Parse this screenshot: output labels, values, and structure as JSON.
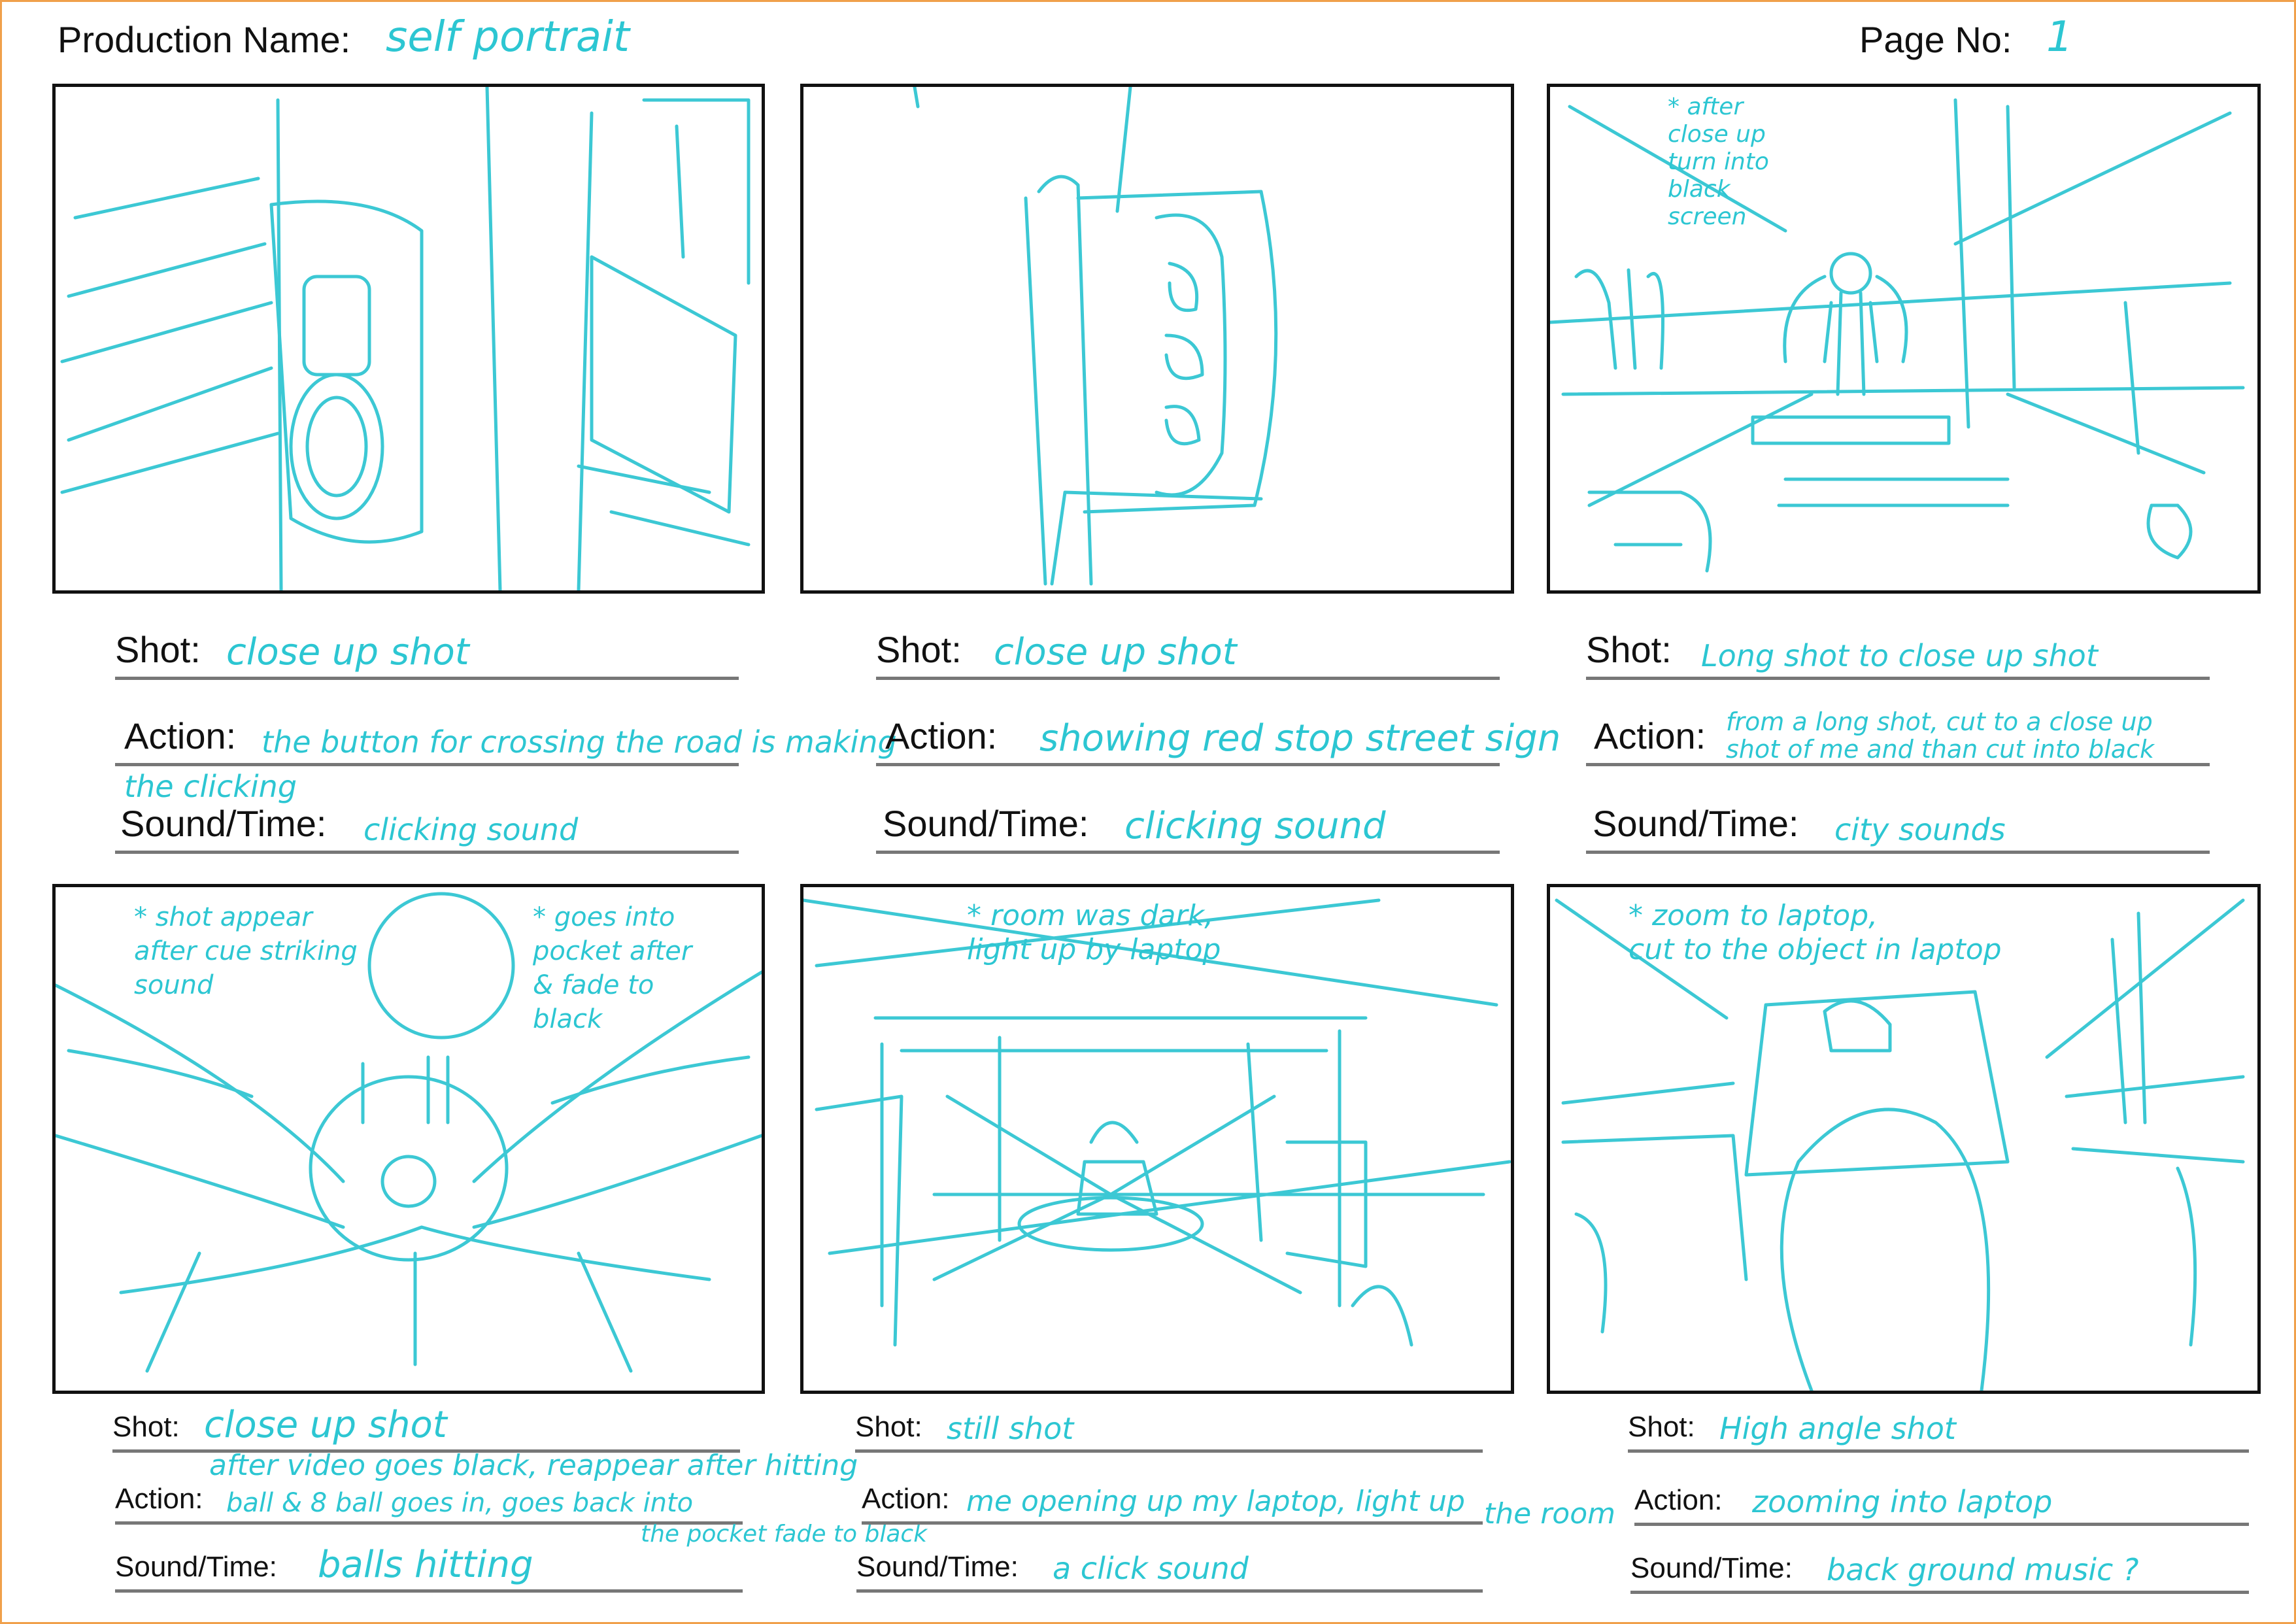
{
  "header": {
    "production_label": "Production Name:",
    "production_value": "self portrait",
    "page_label": "Page No:",
    "page_value": "1"
  },
  "labels": {
    "shot": "Shot:",
    "action": "Action:",
    "sound": "Sound/Time:"
  },
  "panels": [
    {
      "shot": "close up shot",
      "action": "the button for crossing the road is making",
      "action_overflow": "the clicking",
      "sound": "clicking sound",
      "notes": ""
    },
    {
      "shot": "close up shot",
      "action": "showing red stop street sign",
      "sound": "clicking sound",
      "notes": ""
    },
    {
      "shot": "Long shot to close up shot",
      "action_line1": "from a long shot, cut to a close up",
      "action_line2": "shot of me and than cut into black",
      "sound": "city sounds",
      "notes": "* after\nclose up\nturn into\nblack\nscreen"
    },
    {
      "shot": "close up shot",
      "action_above": "after video goes black, reappear after hitting",
      "action": "ball & 8 ball goes in, goes back into",
      "action_below": "the pocket fade to black",
      "sound": "balls hitting",
      "notes_left": "* shot appear\nafter cue striking\nsound",
      "notes_right": "* goes into\npocket after\n& fade to\nblack"
    },
    {
      "shot": "still shot",
      "action": "me opening up my laptop, light up",
      "action_overflow": "the room",
      "sound": "a click sound",
      "notes": "* room was dark,\nlight up by laptop"
    },
    {
      "shot": "High angle shot",
      "action": "zooming into laptop",
      "sound": "back ground music ?",
      "notes": "* zoom to laptop,\ncut to the object in laptop"
    }
  ]
}
